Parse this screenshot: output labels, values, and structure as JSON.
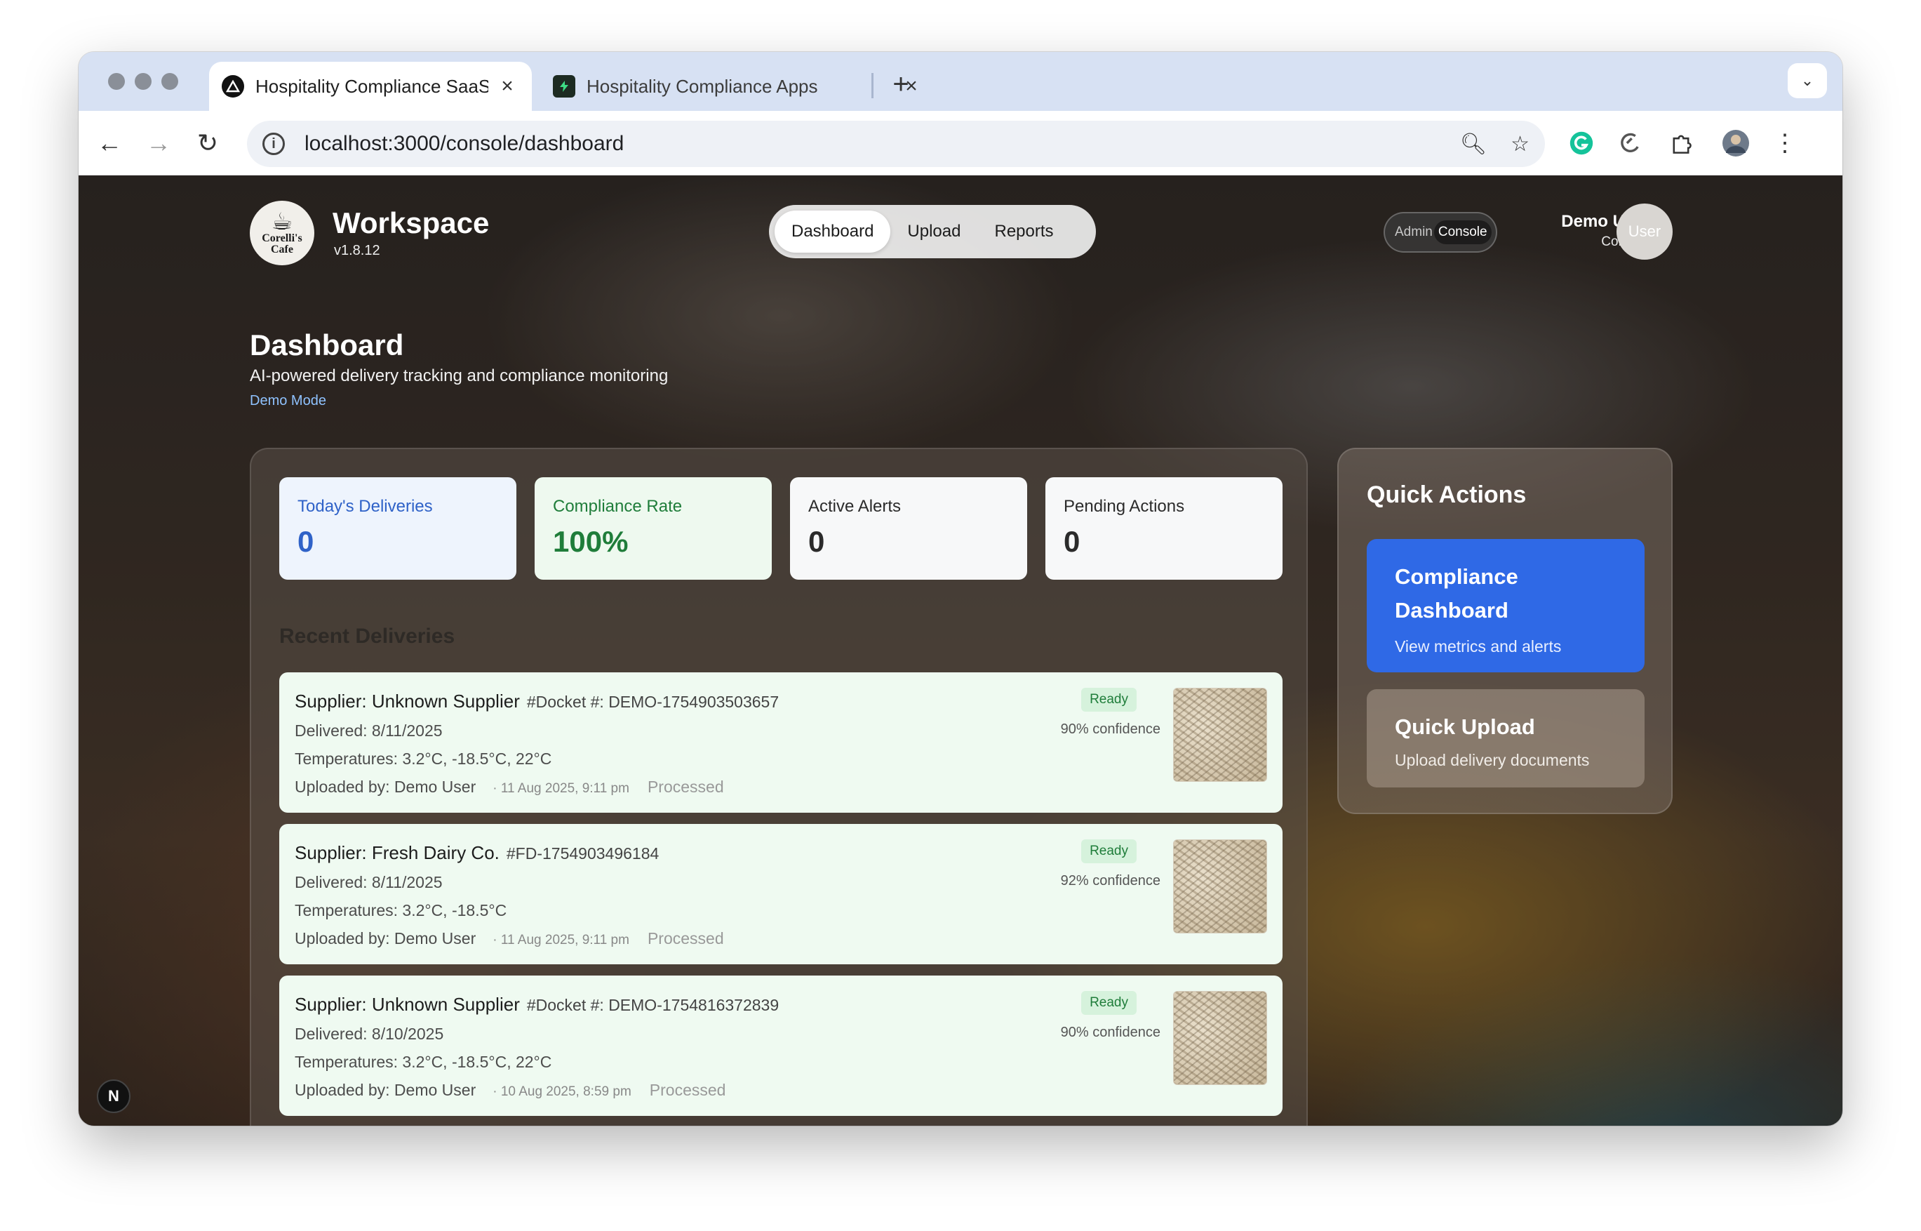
{
  "browser": {
    "tabs": [
      {
        "title": "Hospitality Compliance SaaS",
        "active": true
      },
      {
        "title": "Hospitality Compliance Apps",
        "active": false
      }
    ],
    "url": "localhost:3000/console/dashboard"
  },
  "header": {
    "logo_text": "Corelli's Cafe",
    "workspace_title": "Workspace",
    "version": "v1.8.12",
    "nav": [
      {
        "label": "Dashboard",
        "active": true
      },
      {
        "label": "Upload",
        "active": false
      },
      {
        "label": "Reports",
        "active": false
      }
    ],
    "admin_toggle": {
      "admin": "Admin",
      "console": "Console"
    },
    "user": {
      "name": "Demo User",
      "role": "Console",
      "avatar_text": "User"
    }
  },
  "page": {
    "title": "Dashboard",
    "subtitle": "AI-powered delivery tracking and compliance monitoring",
    "mode": "Demo Mode"
  },
  "stats": [
    {
      "label": "Today's Deliveries",
      "value": "0",
      "color": "#2f62c8"
    },
    {
      "label": "Compliance Rate",
      "value": "100%",
      "color": "#1f7d3a"
    },
    {
      "label": "Active Alerts",
      "value": "0",
      "color": "#2b2b2b"
    },
    {
      "label": "Pending Actions",
      "value": "0",
      "color": "#2b2b2b"
    }
  ],
  "recent": {
    "heading": "Recent Deliveries",
    "items": [
      {
        "supplier": "Supplier: Unknown Supplier",
        "docket": "#Docket #: DEMO-1754903503657",
        "delivered": "Delivered: 8/11/2025",
        "temps": "Temperatures: 3.2°C, -18.5°C, 22°C",
        "uploaded": "Uploaded by: Demo User",
        "timestamp": "· 11 Aug 2025, 9:11 pm",
        "status": "Processed",
        "badge": "Ready",
        "confidence": "90% confidence"
      },
      {
        "supplier": "Supplier: Fresh Dairy Co.",
        "docket": "#FD-1754903496184",
        "delivered": "Delivered: 8/11/2025",
        "temps": "Temperatures: 3.2°C, -18.5°C",
        "uploaded": "Uploaded by: Demo User",
        "timestamp": "· 11 Aug 2025, 9:11 pm",
        "status": "Processed",
        "badge": "Ready",
        "confidence": "92% confidence"
      },
      {
        "supplier": "Supplier: Unknown Supplier",
        "docket": "#Docket #: DEMO-1754816372839",
        "delivered": "Delivered: 8/10/2025",
        "temps": "Temperatures: 3.2°C, -18.5°C, 22°C",
        "uploaded": "Uploaded by: Demo User",
        "timestamp": "· 10 Aug 2025, 8:59 pm",
        "status": "Processed",
        "badge": "Ready",
        "confidence": "90% confidence"
      }
    ]
  },
  "quick_actions": {
    "title": "Quick Actions",
    "cards": [
      {
        "title": "Compliance Dashboard",
        "desc": "View metrics and alerts",
        "color": "#2f69e6"
      },
      {
        "title": "Quick Upload",
        "desc": "Upload delivery documents"
      }
    ]
  },
  "dev_badge": "N"
}
